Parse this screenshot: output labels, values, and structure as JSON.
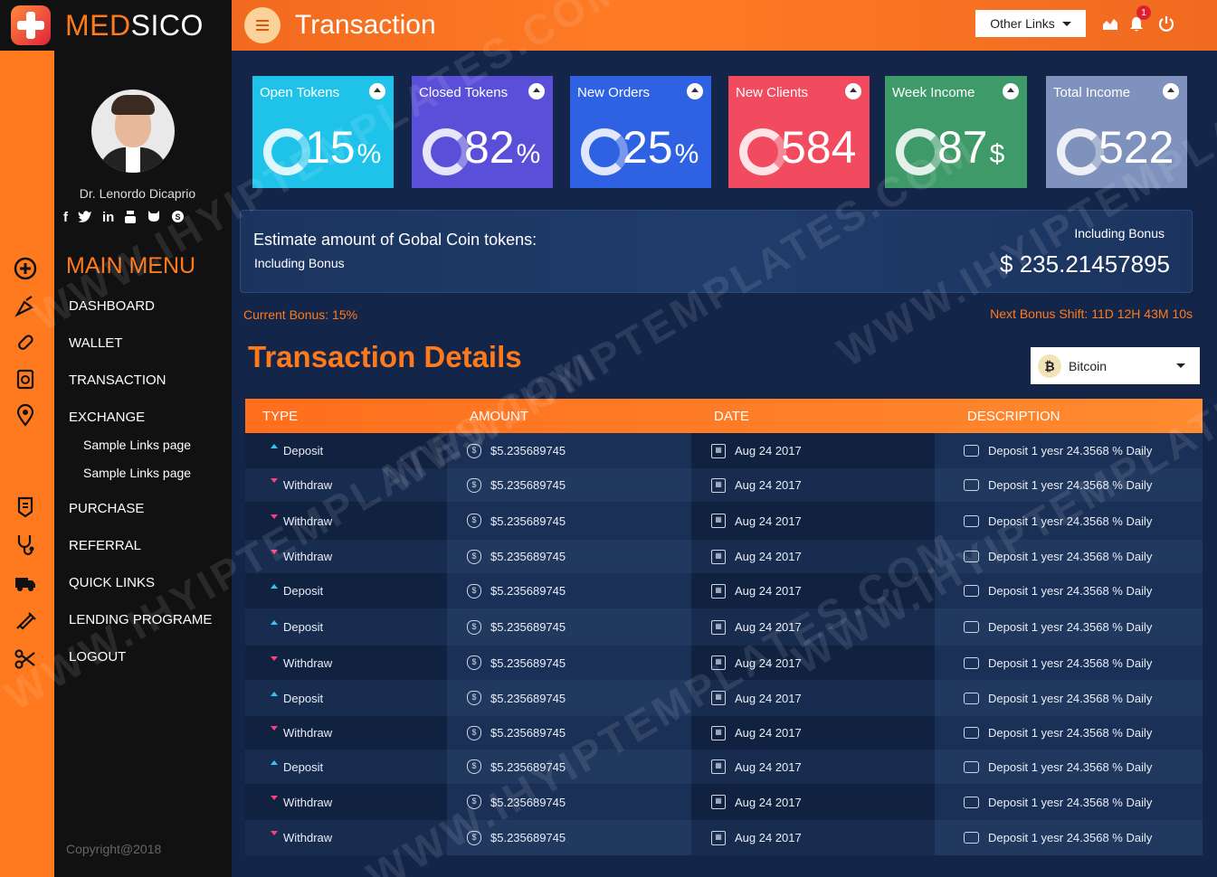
{
  "brand": {
    "name_part1": "MED",
    "name_part2": "SICO"
  },
  "header": {
    "title": "Transaction",
    "other_links": "Other Links",
    "notification_count": "1"
  },
  "profile": {
    "name": "Dr. Lenordo Dicaprio"
  },
  "menu": {
    "title": "MAIN MENU",
    "items": [
      {
        "label": "DASHBOARD"
      },
      {
        "label": "WALLET"
      },
      {
        "label": "TRANSACTION"
      },
      {
        "label": "EXCHANGE"
      },
      {
        "label": "PURCHASE"
      },
      {
        "label": "REFERRAL"
      },
      {
        "label": "QUICK LINKS"
      },
      {
        "label": "LENDING PROGRAME"
      },
      {
        "label": "LOGOUT"
      }
    ],
    "sub_items": [
      {
        "label": "Sample Links page"
      },
      {
        "label": "Sample Links page"
      }
    ]
  },
  "copyright": "Copyright@2018",
  "cards": [
    {
      "title": "Open Tokens",
      "value": "15",
      "unit": "%",
      "color": "#1fc3ea"
    },
    {
      "title": "Closed Tokens",
      "value": "82",
      "unit": "%",
      "color": "#5a4fd8"
    },
    {
      "title": "New Orders",
      "value": "25",
      "unit": "%",
      "color": "#2f62e3"
    },
    {
      "title": "New Clients",
      "value": "584",
      "unit": "",
      "color": "#f24a5e"
    },
    {
      "title": "Week Income",
      "value": "87",
      "unit": "$",
      "color": "#3f9a6a"
    },
    {
      "title": "Total Income",
      "value": "522",
      "unit": "",
      "color": "#7f92bd"
    }
  ],
  "estimate": {
    "title": "Estimate amount of Gobal Coin tokens:",
    "subtitle": "Including Bonus",
    "bonus_label": "Including Bonus",
    "amount": "$ 235.21457895"
  },
  "bonus": {
    "current": "Current Bonus:  15%",
    "next": "Next Bonus Shift: 11D 12H 43M 10s"
  },
  "transactions": {
    "title": "Transaction Details",
    "currency": "Bitcoin",
    "columns": [
      "TYPE",
      "AMOUNT",
      "DATE",
      "DESCRIPTION"
    ],
    "rows": [
      {
        "type": "Deposit",
        "dir": "up",
        "amount": "$5.235689745",
        "date": "Aug 24 2017",
        "desc": "Deposit 1 yesr 24.3568 % Daily"
      },
      {
        "type": "Withdraw",
        "dir": "down",
        "amount": "$5.235689745",
        "date": "Aug 24 2017",
        "desc": "Deposit 1 yesr 24.3568 % Daily"
      },
      {
        "type": "Withdraw",
        "dir": "down",
        "amount": "$5.235689745",
        "date": "Aug 24 2017",
        "desc": "Deposit 1 yesr 24.3568 % Daily"
      },
      {
        "type": "Withdraw",
        "dir": "down",
        "amount": "$5.235689745",
        "date": "Aug 24 2017",
        "desc": "Deposit 1 yesr 24.3568 % Daily"
      },
      {
        "type": "Deposit",
        "dir": "up",
        "amount": "$5.235689745",
        "date": "Aug 24 2017",
        "desc": "Deposit 1 yesr 24.3568 % Daily"
      },
      {
        "type": "Deposit",
        "dir": "up",
        "amount": "$5.235689745",
        "date": "Aug 24 2017",
        "desc": "Deposit 1 yesr 24.3568 % Daily"
      },
      {
        "type": "Withdraw",
        "dir": "down",
        "amount": "$5.235689745",
        "date": "Aug 24 2017",
        "desc": "Deposit 1 yesr 24.3568 % Daily"
      },
      {
        "type": "Deposit",
        "dir": "up",
        "amount": "$5.235689745",
        "date": "Aug 24 2017",
        "desc": "Deposit 1 yesr 24.3568 % Daily"
      },
      {
        "type": "Withdraw",
        "dir": "down",
        "amount": "$5.235689745",
        "date": "Aug 24 2017",
        "desc": "Deposit 1 yesr 24.3568 % Daily"
      },
      {
        "type": "Deposit",
        "dir": "up",
        "amount": "$5.235689745",
        "date": "Aug 24 2017",
        "desc": "Deposit 1 yesr 24.3568 % Daily"
      },
      {
        "type": "Withdraw",
        "dir": "down",
        "amount": "$5.235689745",
        "date": "Aug 24 2017",
        "desc": "Deposit 1 yesr 24.3568 % Daily"
      },
      {
        "type": "Withdraw",
        "dir": "down",
        "amount": "$5.235689745",
        "date": "Aug 24 2017",
        "desc": "Deposit 1 yesr 24.3568 % Daily"
      }
    ]
  },
  "watermark": "WWW.IHYIPTEMPLATES.COM"
}
